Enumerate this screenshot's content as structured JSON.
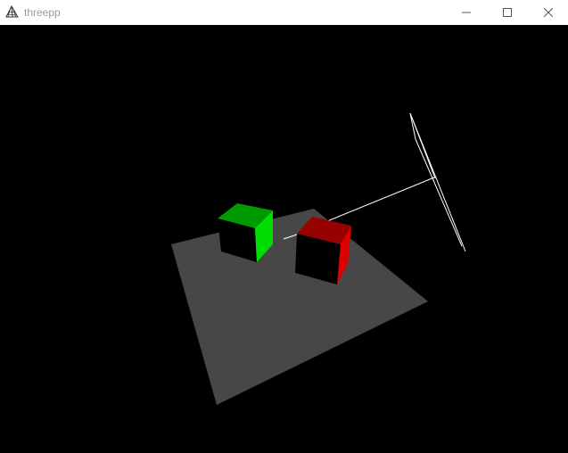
{
  "window": {
    "title": "threepp",
    "app_icon": "threepp-pyramid-icon",
    "controls": {
      "minimize_icon": "minimize-icon",
      "maximize_icon": "maximize-icon",
      "close_icon": "close-icon"
    }
  },
  "scene": {
    "background_color": "#000000",
    "objects": [
      {
        "name": "ground-plane",
        "color": "#474747"
      },
      {
        "name": "green-cube",
        "color": "#00cc00"
      },
      {
        "name": "red-cube",
        "color": "#cc0000"
      },
      {
        "name": "camera-helper",
        "color": "#ffffff"
      }
    ]
  }
}
